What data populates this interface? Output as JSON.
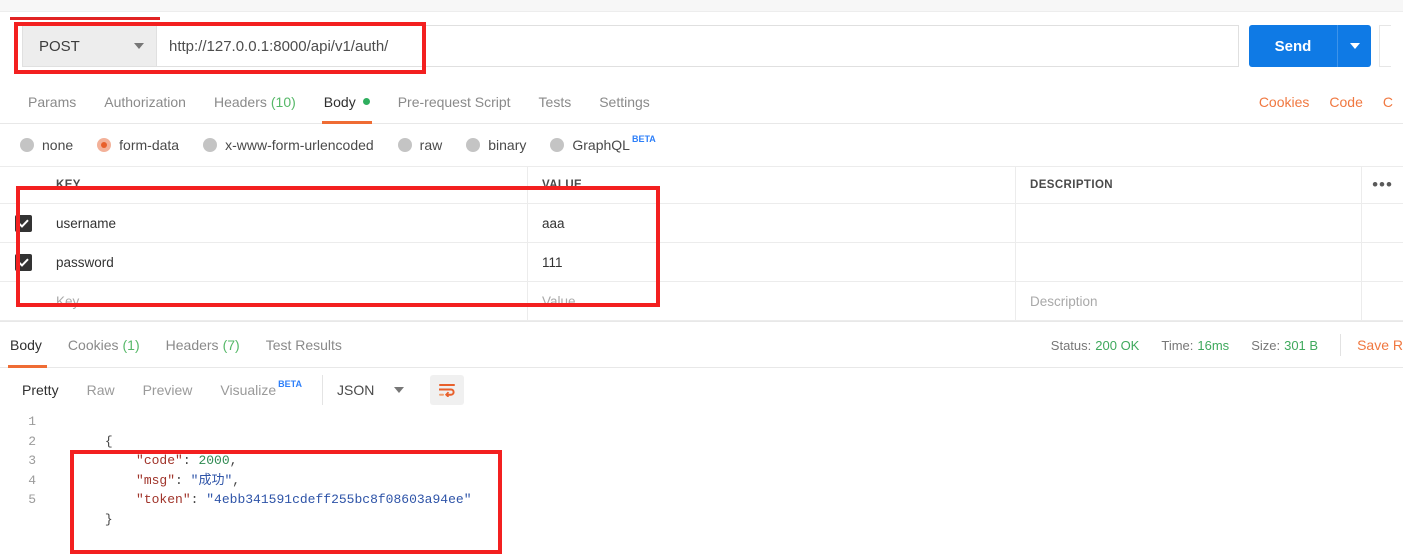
{
  "request": {
    "method": "POST",
    "url": "http://127.0.0.1:8000/api/v1/auth/",
    "send_label": "Send"
  },
  "request_tabs": [
    {
      "label": "Params",
      "count": "",
      "active": false
    },
    {
      "label": "Authorization",
      "count": "",
      "active": false
    },
    {
      "label": "Headers",
      "count": "(10)",
      "active": false
    },
    {
      "label": "Body",
      "count": "",
      "active": true
    },
    {
      "label": "Pre-request Script",
      "count": "",
      "active": false
    },
    {
      "label": "Tests",
      "count": "",
      "active": false
    },
    {
      "label": "Settings",
      "count": "",
      "active": false
    }
  ],
  "request_tabs_right": [
    {
      "label": "Cookies"
    },
    {
      "label": "Code"
    },
    {
      "label": "C"
    }
  ],
  "body_types": [
    {
      "label": "none",
      "selected": false
    },
    {
      "label": "form-data",
      "selected": true
    },
    {
      "label": "x-www-form-urlencoded",
      "selected": false
    },
    {
      "label": "raw",
      "selected": false
    },
    {
      "label": "binary",
      "selected": false
    },
    {
      "label": "GraphQL",
      "selected": false,
      "badge": "BETA"
    }
  ],
  "kv_table": {
    "headers": {
      "key": "KEY",
      "value": "VALUE",
      "description": "DESCRIPTION"
    },
    "more_icon": "•••",
    "rows": [
      {
        "checked": true,
        "key": "username",
        "value": "aaa",
        "description": ""
      },
      {
        "checked": true,
        "key": "password",
        "value": "111",
        "description": ""
      }
    ],
    "placeholders": {
      "key": "Key",
      "value": "Value",
      "description": "Description"
    }
  },
  "response_tabs": [
    {
      "label": "Body",
      "count": "",
      "active": true
    },
    {
      "label": "Cookies",
      "count": "(1)",
      "active": false
    },
    {
      "label": "Headers",
      "count": "(7)",
      "active": false
    },
    {
      "label": "Test Results",
      "count": "",
      "active": false
    }
  ],
  "response_meta": {
    "status_label": "Status:",
    "status_value": "200 OK",
    "time_label": "Time:",
    "time_value": "16ms",
    "size_label": "Size:",
    "size_value": "301 B",
    "save_label": "Save R"
  },
  "view_tabs": [
    {
      "label": "Pretty",
      "active": true
    },
    {
      "label": "Raw",
      "active": false
    },
    {
      "label": "Preview",
      "active": false
    },
    {
      "label": "Visualize",
      "active": false,
      "badge": "BETA"
    }
  ],
  "format_select": "JSON",
  "code": {
    "line_numbers": [
      "1",
      "2",
      "3",
      "4",
      "5"
    ],
    "lines": [
      {
        "raw": "{"
      },
      {
        "key": "\"code\"",
        "sep": ": ",
        "num": "2000",
        "tail": ","
      },
      {
        "key": "\"msg\"",
        "sep": ": ",
        "str": "\"成功\"",
        "tail": ","
      },
      {
        "key": "\"token\"",
        "sep": ": ",
        "str": "\"4ebb341591cdeff255bc8f08603a94ee\"",
        "tail": ""
      },
      {
        "raw": "}"
      }
    ]
  },
  "colors": {
    "accent_orange": "#ef6c34",
    "send_blue": "#0f7ae5",
    "status_green": "#3fa95d",
    "annotation_red": "#f32020",
    "beta_blue": "#2d7ff9"
  }
}
